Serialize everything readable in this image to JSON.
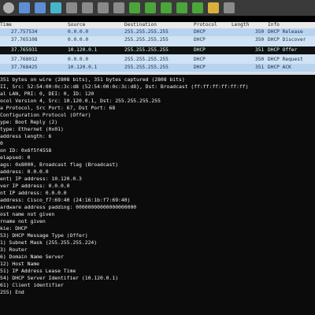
{
  "toolbar": {
    "icons": [
      "gear-icon",
      "window-icon",
      "window-icon",
      "window-icon",
      "window-icon",
      "close-icon",
      "reload-icon",
      "search-icon",
      "back-icon",
      "forward-icon",
      "jump-icon",
      "up-icon",
      "down-icon",
      "colorize-icon",
      "autoscroll-icon"
    ]
  },
  "columns": [
    "Time",
    "Source",
    "Destination",
    "Protocol",
    "Length",
    "Info"
  ],
  "packets": [
    {
      "time": "27.757534",
      "source": "0.0.0.0",
      "destination": "255.255.255.255",
      "protocol": "DHCP",
      "length": "350",
      "info": "DHCP Release"
    },
    {
      "time": "37.765108",
      "source": "0.0.0.0",
      "destination": "255.255.255.255",
      "protocol": "DHCP",
      "length": "350",
      "info": "DHCP Discover"
    },
    {
      "time": "37.765931",
      "source": "10.120.0.1",
      "destination": "255.255.255.255",
      "protocol": "DHCP",
      "length": "351",
      "info": "DHCP Offer"
    },
    {
      "time": "37.768012",
      "source": "0.0.0.0",
      "destination": "255.255.255.255",
      "protocol": "DHCP",
      "length": "350",
      "info": "DHCP Request"
    },
    {
      "time": "37.768425",
      "source": "10.120.0.1",
      "destination": "255.255.255.255",
      "protocol": "DHCP",
      "length": "351",
      "info": "DHCP ACK"
    }
  ],
  "detail_lines": [
    "351 bytes on wire (2808 bits), 351 bytes captured (2808 bits)",
    "II, Src: 52:54:00:0c:3c:d8 (52:54:00:0c:3c:d8), Dst: Broadcast (ff:ff:ff:ff:ff:ff)",
    "al LAN, PRI: 0, DEI: 0, ID: 120",
    "ocol Version 4, Src: 10.120.0.1, Dst: 255.255.255.255",
    "a Protocol, Src Port: 67, Dst Port: 68",
    "Configuration Protocol (Offer)",
    "ype: Boot Reply (2)",
    "type: Ethernet (0x01)",
    "address length: 6",
    "0",
    "on ID: 0x6f5f4558",
    "elapsed: 0",
    "ags: 0x8000, Broadcast flag (Broadcast)",
    "address: 0.0.0.0",
    "ent) IP address: 10.120.0.3",
    "ver IP address: 0.0.0.0",
    "nt IP address: 0.0.0.0",
    "address: Cisco_f7:69:40 (24:16:1b:f7:69:40)",
    "ardware address padding: 00000000000000000000",
    "ost name not given",
    "rname not given",
    "kie: DHCP",
    "53) DHCP Message Type (Offer)",
    "1) Subnet Mask (255.255.255.224)",
    "3) Router",
    "6) Domain Name Server",
    "12) Host Name",
    "51) IP Address Lease Time",
    "54) DHCP Server Identifier (10.120.0.1)",
    "61) Client identifier",
    "255) End"
  ]
}
